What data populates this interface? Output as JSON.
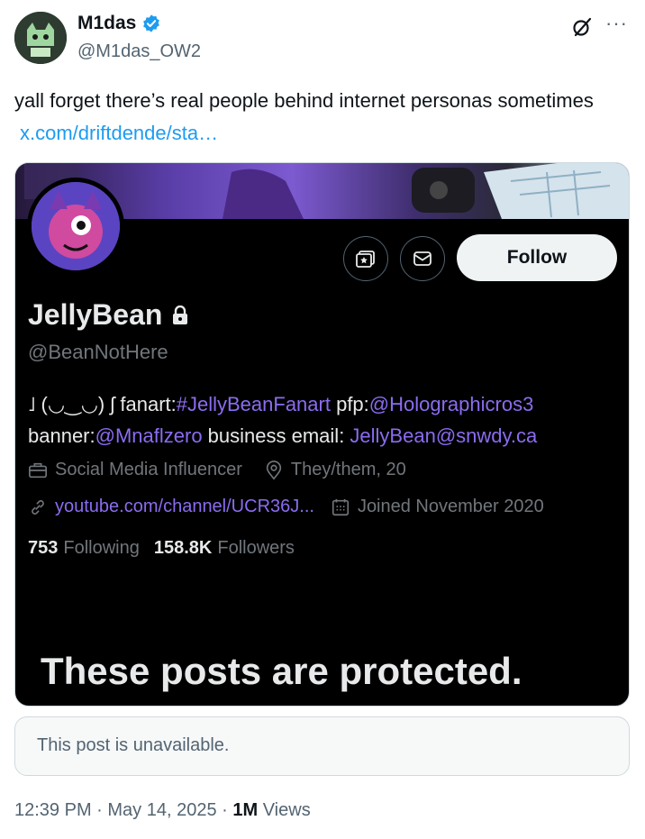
{
  "tweet": {
    "author_name": "M1das",
    "author_handle": "@M1das_OW2",
    "text": "yall forget there’s real people behind internet personas sometimes",
    "link": "x.com/driftdende/sta…",
    "time": "12:39 PM · May 14, 2025 · ",
    "views_count": "1M",
    "views_label": "Views",
    "unavailable": "This post is unavailable."
  },
  "profile": {
    "name": "JellyBean",
    "handle": "@BeanNotHere",
    "follow_label": "Follow",
    "bio_prefix": "˩ (◡‿◡) ʃ fanart:",
    "bio_hashtag": "#JellyBeanFanart",
    "bio_pfp": " pfp:",
    "bio_pfp_mention": "@Holographicros3",
    "bio_banner": "banner:",
    "bio_banner_mention": "@Mnaflzero",
    "bio_business": " business email: ",
    "bio_email": "JellyBean@snwdy.ca",
    "category": "Social Media Influencer",
    "location": "They/them, 20",
    "website": "youtube.com/channel/UCR36J...",
    "joined": "Joined November 2020",
    "following_count": "753",
    "following_label": "Following",
    "followers_count": "158.8K",
    "followers_label": "Followers",
    "protected_notice": "These posts are protected."
  },
  "colors": {
    "link_blue": "#1d9bf0",
    "mention_purple": "#8b6cf0",
    "verified_blue": "#1d9bf0"
  }
}
